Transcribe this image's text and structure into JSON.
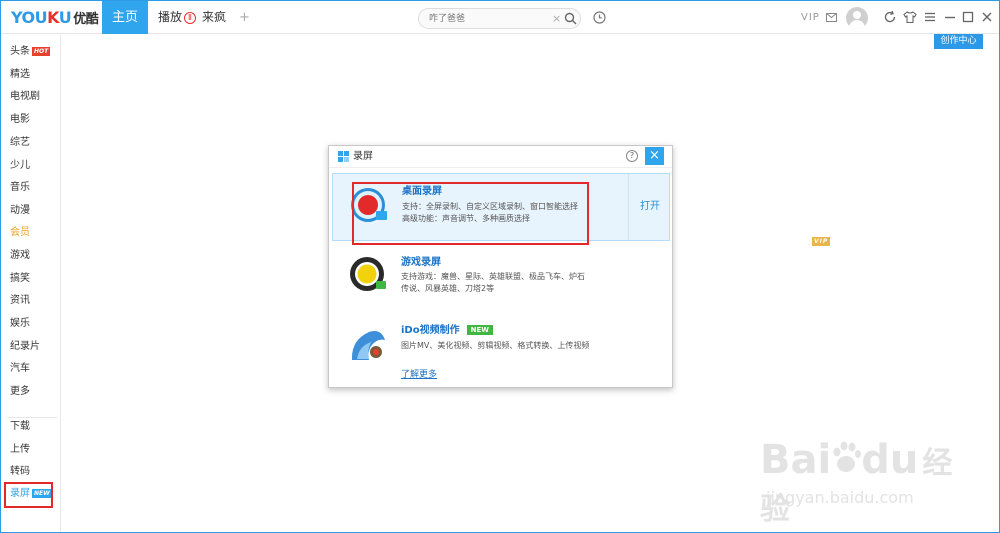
{
  "app": {
    "logo_latin": "YOUKU",
    "logo_cn": "优酷",
    "nav": {
      "home": "主页",
      "play": "播放",
      "play_badge": "Ⅱ",
      "laifeng": "来疯",
      "add": "+"
    },
    "search": {
      "placeholder": "咋了爸爸"
    },
    "vip_label": "VIP",
    "create_center": "创作中心"
  },
  "sidebar": {
    "items": [
      {
        "label": "头条",
        "tag": "HOT"
      },
      {
        "label": "精选"
      },
      {
        "label": "电视剧"
      },
      {
        "label": "电影"
      },
      {
        "label": "综艺"
      },
      {
        "label": "少儿"
      },
      {
        "label": "音乐"
      },
      {
        "label": "动漫"
      },
      {
        "label": "会员",
        "tag": "VIP"
      },
      {
        "label": "游戏"
      },
      {
        "label": "搞笑"
      },
      {
        "label": "资讯"
      },
      {
        "label": "娱乐"
      },
      {
        "label": "纪录片"
      },
      {
        "label": "汽车"
      },
      {
        "label": "更多"
      }
    ],
    "tools": [
      {
        "label": "下载"
      },
      {
        "label": "上传"
      },
      {
        "label": "转码"
      },
      {
        "label": "录屏",
        "tag": "NEW"
      }
    ]
  },
  "dialog": {
    "title": "录屏",
    "help": "?",
    "close": "×",
    "options": [
      {
        "title": "桌面录屏",
        "desc1": "支持：全屏录制、自定义区域录制、窗口智能选择",
        "desc2": "高级功能：声音调节、多种画质选择",
        "action": "打开"
      },
      {
        "title": "游戏录屏",
        "desc1": "支持游戏：魔兽、星际、英雄联盟、极品飞车、炉石",
        "desc2": "传说、风暴英雄、刀塔2等"
      },
      {
        "title": "iDo视频制作",
        "tag": "NEW",
        "desc1": "图片MV、美化视频、剪辑视频、格式转换、上传视频",
        "link": "了解更多"
      }
    ]
  },
  "watermark": {
    "brand": "Bai",
    "brand2": "du",
    "cn": "经验",
    "url": "jingyan.baidu.com"
  },
  "colors": {
    "accent": "#2fa5ee",
    "highlight_border": "#e22a2a",
    "link": "#1a73c8"
  }
}
